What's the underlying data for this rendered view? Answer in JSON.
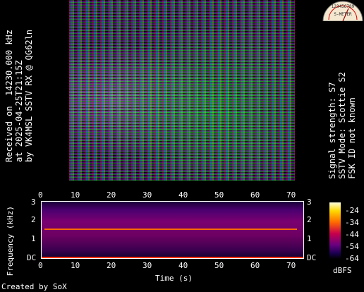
{
  "rx_info": {
    "line1": "Received on  14230.000 kHz",
    "line2": "at 2025-04-25T21:15Z",
    "line3": "by VK4MSL SSTV RX @ QG62ln"
  },
  "signal_info": {
    "line1": "Signal strength: S7",
    "line2": "SSTV Mode: Scottie S2",
    "line3": "FSK ID not known"
  },
  "smeter": {
    "scale": "123456789",
    "label": "S-METER"
  },
  "spectrogram": {
    "x_label": "Time (s)",
    "y_label": "Frequency (kHz)",
    "x_ticks": [
      "0",
      "10",
      "20",
      "30",
      "40",
      "50",
      "60",
      "70"
    ],
    "y_ticks": [
      "3",
      "2",
      "1",
      "DC"
    ],
    "colorbar_ticks": [
      "-24",
      "-34",
      "-44",
      "-54",
      "-64"
    ],
    "colorbar_unit": "dBFS"
  },
  "credit": "Created by SoX"
}
